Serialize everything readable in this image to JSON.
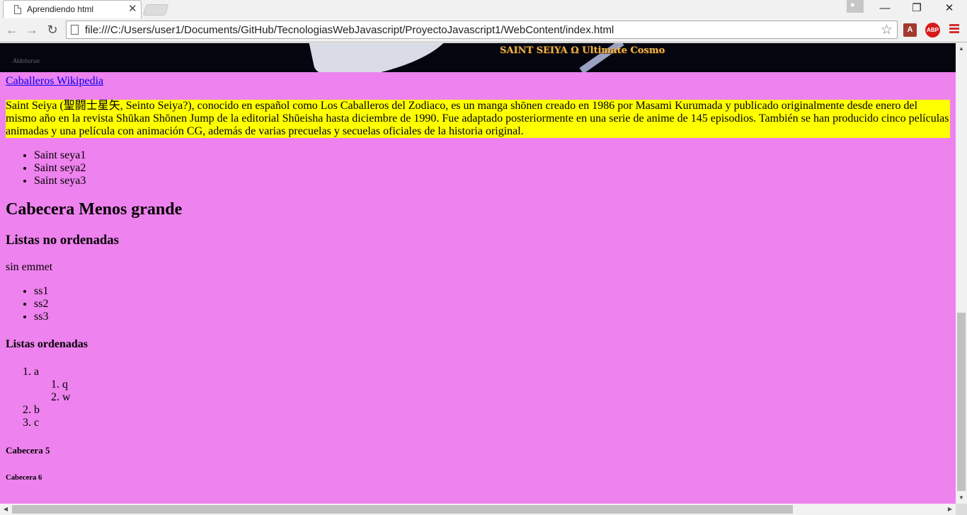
{
  "browser": {
    "tab_title": "Aprendiendo html",
    "tab_close": "✕",
    "url": "file:///C:/Users/user1/Documents/GitHub/TecnologiasWebJavascript/ProyectoJavascript1/WebContent/index.html",
    "nav": {
      "back": "←",
      "forward": "→",
      "reload": "↻",
      "star": "☆"
    },
    "window": {
      "minimize": "—",
      "maximize": "❐",
      "close": "✕"
    },
    "extensions": {
      "pdf": "A",
      "adblock": "ABP"
    }
  },
  "banner": {
    "logo_text": "SAINT SEIYA Ω  Ultimate Cosmo",
    "signature": "Aldebaran"
  },
  "page": {
    "link_text": "Caballeros Wikipedia",
    "intro_paragraph": "Saint Seiya (聖闘士星矢, Seinto Seiya?), conocido en español como Los Caballeros del Zodiaco, es un manga shōnen creado en 1986 por Masami Kurumada y publicado originalmente desde enero del mismo año en la revista Shūkan Shōnen Jump de la editorial Shūeisha hasta diciembre de 1990. Fue adaptado posteriormente en una serie de anime de 145 episodios. También se han producido cinco películas animadas y una película con animación CG, además de varias precuelas y secuelas oficiales de la historia original.",
    "first_list": [
      "Saint seya1",
      "Saint seya2",
      "Saint seya3"
    ],
    "h2": "Cabecera Menos grande",
    "h3": "Listas no ordenadas",
    "plain_text": "sin emmet",
    "unordered_list": [
      "ss1",
      "ss2",
      "ss3"
    ],
    "h4": "Listas ordenadas",
    "ordered_list": {
      "a": "a",
      "nested": [
        "q",
        "w"
      ],
      "b": "b",
      "c": "c"
    },
    "h5": "Cabecera 5",
    "h6": "Cabecera 6"
  },
  "scrollbars": {
    "up": "▲",
    "down": "▼",
    "left": "◀",
    "right": "▶"
  },
  "colors": {
    "page_background": "#ee82ee",
    "highlight": "#ffff00",
    "link": "#0000ee",
    "menu_icon": "#d32f2f"
  }
}
